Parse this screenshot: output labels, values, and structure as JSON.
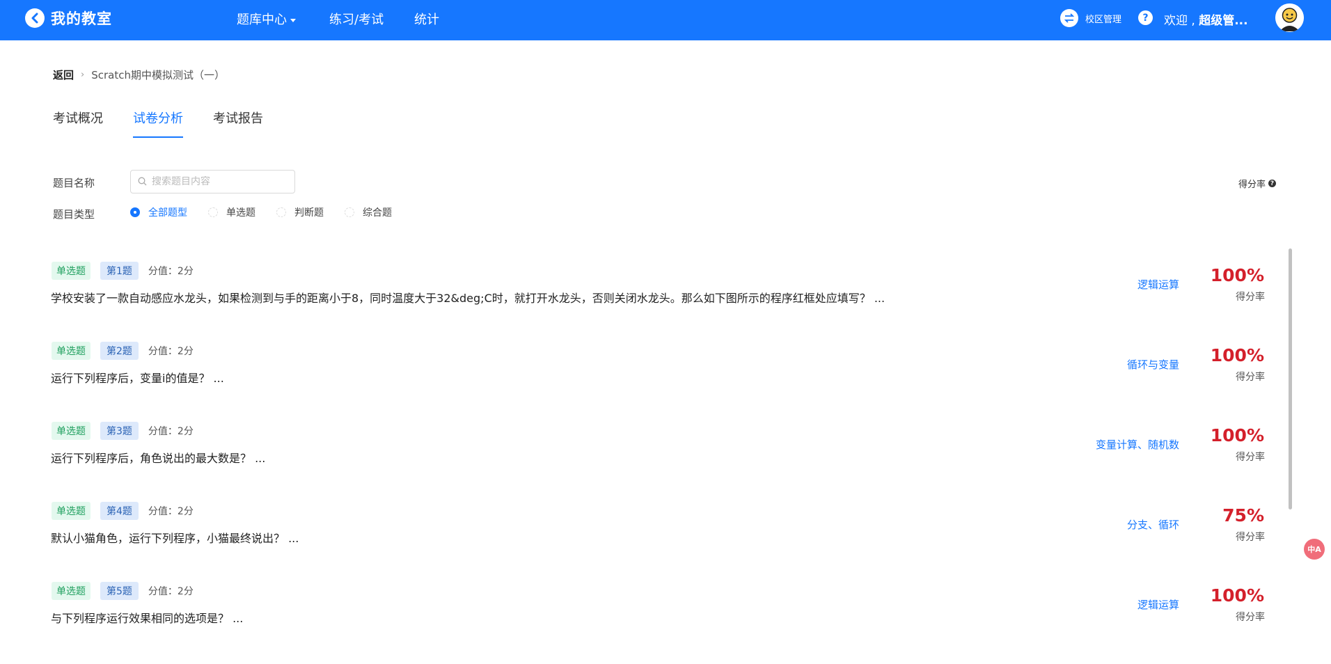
{
  "app": {
    "title": "我的教室"
  },
  "nav": {
    "items": [
      {
        "label": "题库中心"
      },
      {
        "label": "练习/考试"
      },
      {
        "label": "统计"
      }
    ],
    "switch_label": "校区管理",
    "help": "?",
    "welcome_prefix": "欢迎 , ",
    "welcome_user": "超级管..."
  },
  "breadcrumb": {
    "back": "返回",
    "current": "Scratch期中模拟测试（一）"
  },
  "tabs": [
    {
      "label": "考试概况"
    },
    {
      "label": "试卷分析"
    },
    {
      "label": "考试报告"
    }
  ],
  "filters": {
    "name_label": "题目名称",
    "search_placeholder": "搜索题目内容",
    "type_label": "题目类型",
    "types": [
      {
        "label": "全部题型"
      },
      {
        "label": "单选题"
      },
      {
        "label": "判断题"
      },
      {
        "label": "综合题"
      }
    ],
    "score_rate_head": "得分率"
  },
  "questions": [
    {
      "type": "单选题",
      "num": "第1题",
      "points": "分值：2分",
      "text": "学校安装了一款自动感应水龙头，如果检测到与手的距离小于8，同时温度大于32&deg;C时，就打开水龙头，否则关闭水龙头。那么如下图所示的程序红框处应填写？ ...",
      "knowledge": "逻辑运算",
      "rate": "100%",
      "rate_label": "得分率"
    },
    {
      "type": "单选题",
      "num": "第2题",
      "points": "分值：2分",
      "text": "运行下列程序后，变量i的值是？ ...",
      "knowledge": "循环与变量",
      "rate": "100%",
      "rate_label": "得分率"
    },
    {
      "type": "单选题",
      "num": "第3题",
      "points": "分值：2分",
      "text": "运行下列程序后，角色说出的最大数是？ ...",
      "knowledge": "变量计算、随机数",
      "rate": "100%",
      "rate_label": "得分率"
    },
    {
      "type": "单选题",
      "num": "第4题",
      "points": "分值：2分",
      "text": "默认小猫角色，运行下列程序，小猫最终说出？ ...",
      "knowledge": "分支、循环",
      "rate": "75%",
      "rate_label": "得分率"
    },
    {
      "type": "单选题",
      "num": "第5题",
      "points": "分值：2分",
      "text": "与下列程序运行效果相同的选项是？ ...",
      "knowledge": "逻辑运算",
      "rate": "100%",
      "rate_label": "得分率"
    }
  ],
  "colors": {
    "brand": "#1677ff",
    "rate": "#d4202b",
    "tag_type_bg": "#e3f8ee",
    "tag_num_bg": "#dde9fb"
  },
  "icons": {
    "back": "chevron-left-icon",
    "switch": "swap-icon",
    "search": "search-icon",
    "translate": "translate-icon"
  },
  "translate_badge": "中A"
}
